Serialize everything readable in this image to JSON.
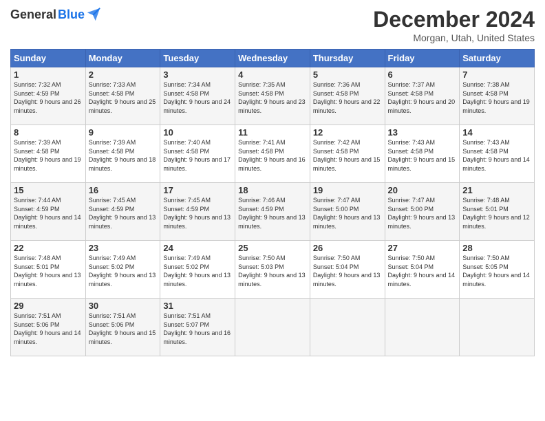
{
  "header": {
    "logo_general": "General",
    "logo_blue": "Blue",
    "title": "December 2024",
    "subtitle": "Morgan, Utah, United States"
  },
  "calendar": {
    "days_of_week": [
      "Sunday",
      "Monday",
      "Tuesday",
      "Wednesday",
      "Thursday",
      "Friday",
      "Saturday"
    ],
    "weeks": [
      [
        {
          "day": "",
          "info": ""
        },
        {
          "day": "2",
          "info": "Sunrise: 7:33 AM\nSunset: 4:58 PM\nDaylight: 9 hours\nand 25 minutes."
        },
        {
          "day": "3",
          "info": "Sunrise: 7:34 AM\nSunset: 4:58 PM\nDaylight: 9 hours\nand 24 minutes."
        },
        {
          "day": "4",
          "info": "Sunrise: 7:35 AM\nSunset: 4:58 PM\nDaylight: 9 hours\nand 23 minutes."
        },
        {
          "day": "5",
          "info": "Sunrise: 7:36 AM\nSunset: 4:58 PM\nDaylight: 9 hours\nand 22 minutes."
        },
        {
          "day": "6",
          "info": "Sunrise: 7:37 AM\nSunset: 4:58 PM\nDaylight: 9 hours\nand 20 minutes."
        },
        {
          "day": "7",
          "info": "Sunrise: 7:38 AM\nSunset: 4:58 PM\nDaylight: 9 hours\nand 19 minutes."
        }
      ],
      [
        {
          "day": "8",
          "info": "Sunrise: 7:39 AM\nSunset: 4:58 PM\nDaylight: 9 hours\nand 19 minutes."
        },
        {
          "day": "9",
          "info": "Sunrise: 7:39 AM\nSunset: 4:58 PM\nDaylight: 9 hours\nand 18 minutes."
        },
        {
          "day": "10",
          "info": "Sunrise: 7:40 AM\nSunset: 4:58 PM\nDaylight: 9 hours\nand 17 minutes."
        },
        {
          "day": "11",
          "info": "Sunrise: 7:41 AM\nSunset: 4:58 PM\nDaylight: 9 hours\nand 16 minutes."
        },
        {
          "day": "12",
          "info": "Sunrise: 7:42 AM\nSunset: 4:58 PM\nDaylight: 9 hours\nand 15 minutes."
        },
        {
          "day": "13",
          "info": "Sunrise: 7:43 AM\nSunset: 4:58 PM\nDaylight: 9 hours\nand 15 minutes."
        },
        {
          "day": "14",
          "info": "Sunrise: 7:43 AM\nSunset: 4:58 PM\nDaylight: 9 hours\nand 14 minutes."
        }
      ],
      [
        {
          "day": "15",
          "info": "Sunrise: 7:44 AM\nSunset: 4:59 PM\nDaylight: 9 hours\nand 14 minutes."
        },
        {
          "day": "16",
          "info": "Sunrise: 7:45 AM\nSunset: 4:59 PM\nDaylight: 9 hours\nand 13 minutes."
        },
        {
          "day": "17",
          "info": "Sunrise: 7:45 AM\nSunset: 4:59 PM\nDaylight: 9 hours\nand 13 minutes."
        },
        {
          "day": "18",
          "info": "Sunrise: 7:46 AM\nSunset: 4:59 PM\nDaylight: 9 hours\nand 13 minutes."
        },
        {
          "day": "19",
          "info": "Sunrise: 7:47 AM\nSunset: 5:00 PM\nDaylight: 9 hours\nand 13 minutes."
        },
        {
          "day": "20",
          "info": "Sunrise: 7:47 AM\nSunset: 5:00 PM\nDaylight: 9 hours\nand 13 minutes."
        },
        {
          "day": "21",
          "info": "Sunrise: 7:48 AM\nSunset: 5:01 PM\nDaylight: 9 hours\nand 12 minutes."
        }
      ],
      [
        {
          "day": "22",
          "info": "Sunrise: 7:48 AM\nSunset: 5:01 PM\nDaylight: 9 hours\nand 13 minutes."
        },
        {
          "day": "23",
          "info": "Sunrise: 7:49 AM\nSunset: 5:02 PM\nDaylight: 9 hours\nand 13 minutes."
        },
        {
          "day": "24",
          "info": "Sunrise: 7:49 AM\nSunset: 5:02 PM\nDaylight: 9 hours\nand 13 minutes."
        },
        {
          "day": "25",
          "info": "Sunrise: 7:50 AM\nSunset: 5:03 PM\nDaylight: 9 hours\nand 13 minutes."
        },
        {
          "day": "26",
          "info": "Sunrise: 7:50 AM\nSunset: 5:04 PM\nDaylight: 9 hours\nand 13 minutes."
        },
        {
          "day": "27",
          "info": "Sunrise: 7:50 AM\nSunset: 5:04 PM\nDaylight: 9 hours\nand 14 minutes."
        },
        {
          "day": "28",
          "info": "Sunrise: 7:50 AM\nSunset: 5:05 PM\nDaylight: 9 hours\nand 14 minutes."
        }
      ],
      [
        {
          "day": "29",
          "info": "Sunrise: 7:51 AM\nSunset: 5:06 PM\nDaylight: 9 hours\nand 14 minutes."
        },
        {
          "day": "30",
          "info": "Sunrise: 7:51 AM\nSunset: 5:06 PM\nDaylight: 9 hours\nand 15 minutes."
        },
        {
          "day": "31",
          "info": "Sunrise: 7:51 AM\nSunset: 5:07 PM\nDaylight: 9 hours\nand 16 minutes."
        },
        {
          "day": "",
          "info": ""
        },
        {
          "day": "",
          "info": ""
        },
        {
          "day": "",
          "info": ""
        },
        {
          "day": "",
          "info": ""
        }
      ]
    ],
    "first_row": [
      {
        "day": "1",
        "info": "Sunrise: 7:32 AM\nSunset: 4:59 PM\nDaylight: 9 hours\nand 26 minutes."
      }
    ]
  }
}
